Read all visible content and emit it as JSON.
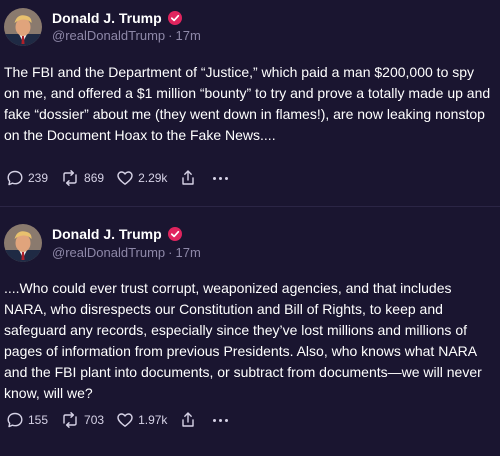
{
  "theme": {
    "background": "#1a1530",
    "text": "#ffffff",
    "muted": "#8e88a8",
    "verified_badge": "#e0245e"
  },
  "posts": [
    {
      "author": "Donald J. Trump",
      "handle": "@realDonaldTrump",
      "time": "17m",
      "avatar_icon": "profile-photo",
      "text": "The FBI and the Department of “Justice,” which paid a man $200,000 to spy on me, and offered a $1 million “bounty” to try and prove a totally made up and fake “dossier” about me (they went down in flames!), are now leaking nonstop on the Document Hoax to the Fake News....",
      "replies": "239",
      "retruths": "869",
      "likes": "2.29k"
    },
    {
      "author": "Donald J. Trump",
      "handle": "@realDonaldTrump",
      "time": "17m",
      "avatar_icon": "profile-photo",
      "text": "....Who could ever trust corrupt, weaponized agencies, and that includes NARA, who disrespects our Constitution and Bill of Rights, to keep and safeguard any records, especially since they’ve lost millions and millions of pages of information from previous Presidents. Also, who knows what NARA and the FBI plant into documents, or subtract from documents—we will never know, will we?",
      "replies": "155",
      "retruths": "703",
      "likes": "1.97k"
    }
  ],
  "icons": {
    "reply": "reply-icon",
    "retruth": "retruth-icon",
    "like": "heart-icon",
    "share": "share-icon",
    "more": "more-icon",
    "verified": "verified-badge-icon"
  }
}
